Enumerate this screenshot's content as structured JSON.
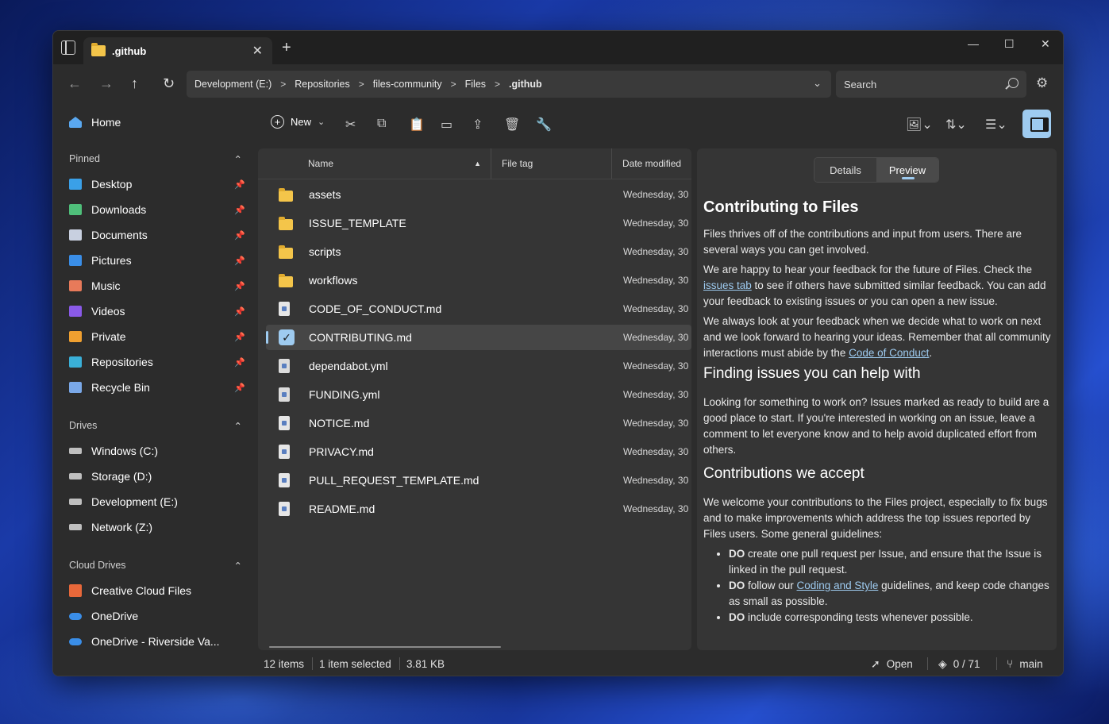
{
  "tab": {
    "title": ".github"
  },
  "address": {
    "crumbs": [
      "Development (E:)",
      "Repositories",
      "files-community",
      "Files",
      ".github"
    ]
  },
  "search": {
    "placeholder": "Search"
  },
  "sidebar": {
    "home": "Home",
    "pinned_header": "Pinned",
    "pinned": [
      {
        "label": "Desktop",
        "color": "#3aa0e8"
      },
      {
        "label": "Downloads",
        "color": "#4fbf7a"
      },
      {
        "label": "Documents",
        "color": "#c8d0e0"
      },
      {
        "label": "Pictures",
        "color": "#3a8ee8"
      },
      {
        "label": "Music",
        "color": "#e87a5a"
      },
      {
        "label": "Videos",
        "color": "#8a5ae8"
      },
      {
        "label": "Private",
        "color": "#f0a030"
      },
      {
        "label": "Repositories",
        "color": "#3ab0d8"
      },
      {
        "label": "Recycle Bin",
        "color": "#7aa8e8"
      }
    ],
    "drives_header": "Drives",
    "drives": [
      "Windows (C:)",
      "Storage (D:)",
      "Development (E:)",
      "Network (Z:)"
    ],
    "cloud_header": "Cloud Drives",
    "cloud": [
      "Creative Cloud Files",
      "OneDrive",
      "OneDrive - Riverside Va..."
    ]
  },
  "toolbar": {
    "new_label": "New"
  },
  "columns": {
    "name": "Name",
    "file_tag": "File tag",
    "date_modified": "Date modified"
  },
  "files": [
    {
      "name": "assets",
      "type": "folder",
      "date": "Wednesday, 30"
    },
    {
      "name": "ISSUE_TEMPLATE",
      "type": "folder",
      "date": "Wednesday, 30"
    },
    {
      "name": "scripts",
      "type": "folder",
      "date": "Wednesday, 30"
    },
    {
      "name": "workflows",
      "type": "folder",
      "date": "Wednesday, 30"
    },
    {
      "name": "CODE_OF_CONDUCT.md",
      "type": "md",
      "date": "Wednesday, 30"
    },
    {
      "name": "CONTRIBUTING.md",
      "type": "md",
      "date": "Wednesday, 30",
      "selected": true
    },
    {
      "name": "dependabot.yml",
      "type": "yml",
      "date": "Wednesday, 30"
    },
    {
      "name": "FUNDING.yml",
      "type": "yml",
      "date": "Wednesday, 30"
    },
    {
      "name": "NOTICE.md",
      "type": "md",
      "date": "Wednesday, 30"
    },
    {
      "name": "PRIVACY.md",
      "type": "md",
      "date": "Wednesday, 30"
    },
    {
      "name": "PULL_REQUEST_TEMPLATE.md",
      "type": "md",
      "date": "Wednesday, 30"
    },
    {
      "name": "README.md",
      "type": "md",
      "date": "Wednesday, 30"
    }
  ],
  "preview": {
    "tab_details": "Details",
    "tab_preview": "Preview",
    "h1": "Contributing to Files",
    "p1": "Files thrives off of the contributions and input from users. There are several ways you can get involved.",
    "p2_a": "We are happy to hear your feedback for the future of Files. Check the ",
    "p2_link": "issues tab",
    "p2_b": " to see if others have submitted similar feedback. You can add your feedback to existing issues or you can open a new issue.",
    "p3_a": "We always look at your feedback when we decide what to work on next and we look forward to hearing your ideas. Remember that all community interactions must abide by the ",
    "p3_link": "Code of Conduct",
    "p3_b": ".",
    "h2a": "Finding issues you can help with",
    "p4": "Looking for something to work on? Issues marked as ready to build are a good place to start. If you're interested in working on an issue, leave a comment to let everyone know and to help avoid duplicated effort from others.",
    "h2b": "Contributions we accept",
    "p5": "We welcome your contributions to the Files project, especially to fix bugs and to make improvements which address the top issues reported by Files users. Some general guidelines:",
    "li1_b": "DO",
    "li1": " create one pull request per Issue, and ensure that the Issue is linked in the pull request.",
    "li2_b": "DO",
    "li2_a": " follow our ",
    "li2_link": "Coding and Style",
    "li2_c": " guidelines, and keep code changes as small as possible.",
    "li3_b": "DO",
    "li3": " include corresponding tests whenever possible."
  },
  "status": {
    "items": "12 items",
    "selected": "1 item selected",
    "size": "3.81 KB",
    "open": "Open",
    "changes": "0 / 71",
    "branch": "main"
  }
}
